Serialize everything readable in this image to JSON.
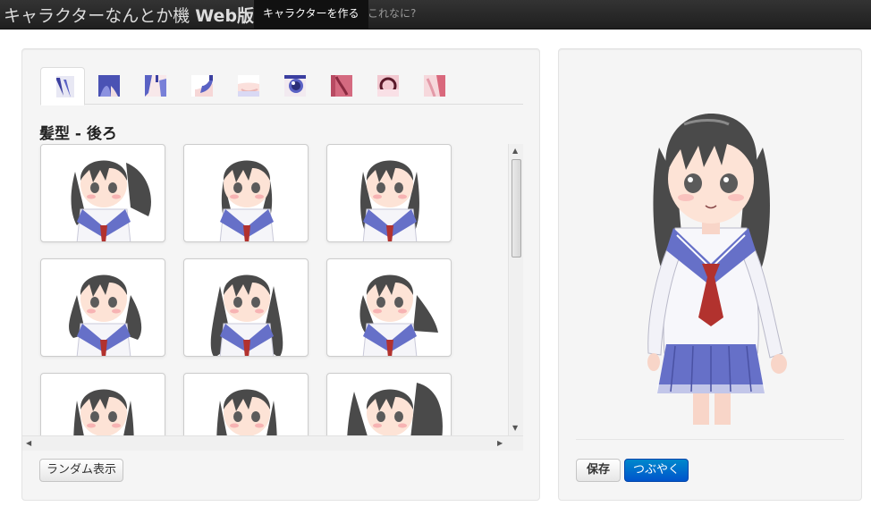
{
  "navbar": {
    "brand_prefix": "キャラクターなんとか機 ",
    "brand_suffix": "Web版",
    "items": [
      {
        "label": "キャラクターを作る",
        "active": true
      },
      {
        "label": "これなに?",
        "active": false
      }
    ]
  },
  "editor": {
    "tabs": [
      {
        "icon": "hair-back-icon",
        "active": true
      },
      {
        "icon": "hair-front-icon",
        "active": false
      },
      {
        "icon": "hair-side-icon",
        "active": false
      },
      {
        "icon": "ahoge-icon",
        "active": false
      },
      {
        "icon": "face-icon",
        "active": false
      },
      {
        "icon": "eyes-icon",
        "active": false
      },
      {
        "icon": "eyes-color-icon",
        "active": false
      },
      {
        "icon": "mouth-icon",
        "active": false
      },
      {
        "icon": "accessory-icon",
        "active": false
      }
    ],
    "section_title": "髪型 - 後ろ",
    "option_count_visible": 9,
    "random_label": "ランダム表示"
  },
  "preview": {
    "save_label": "保存",
    "tweet_label": "つぶやく"
  },
  "colors": {
    "hair": "#4a4a4a",
    "skin": "#fde3d6",
    "uniform_collar": "#6670c8",
    "tie": "#b2322e",
    "tab_accent": "#5a62c4"
  }
}
